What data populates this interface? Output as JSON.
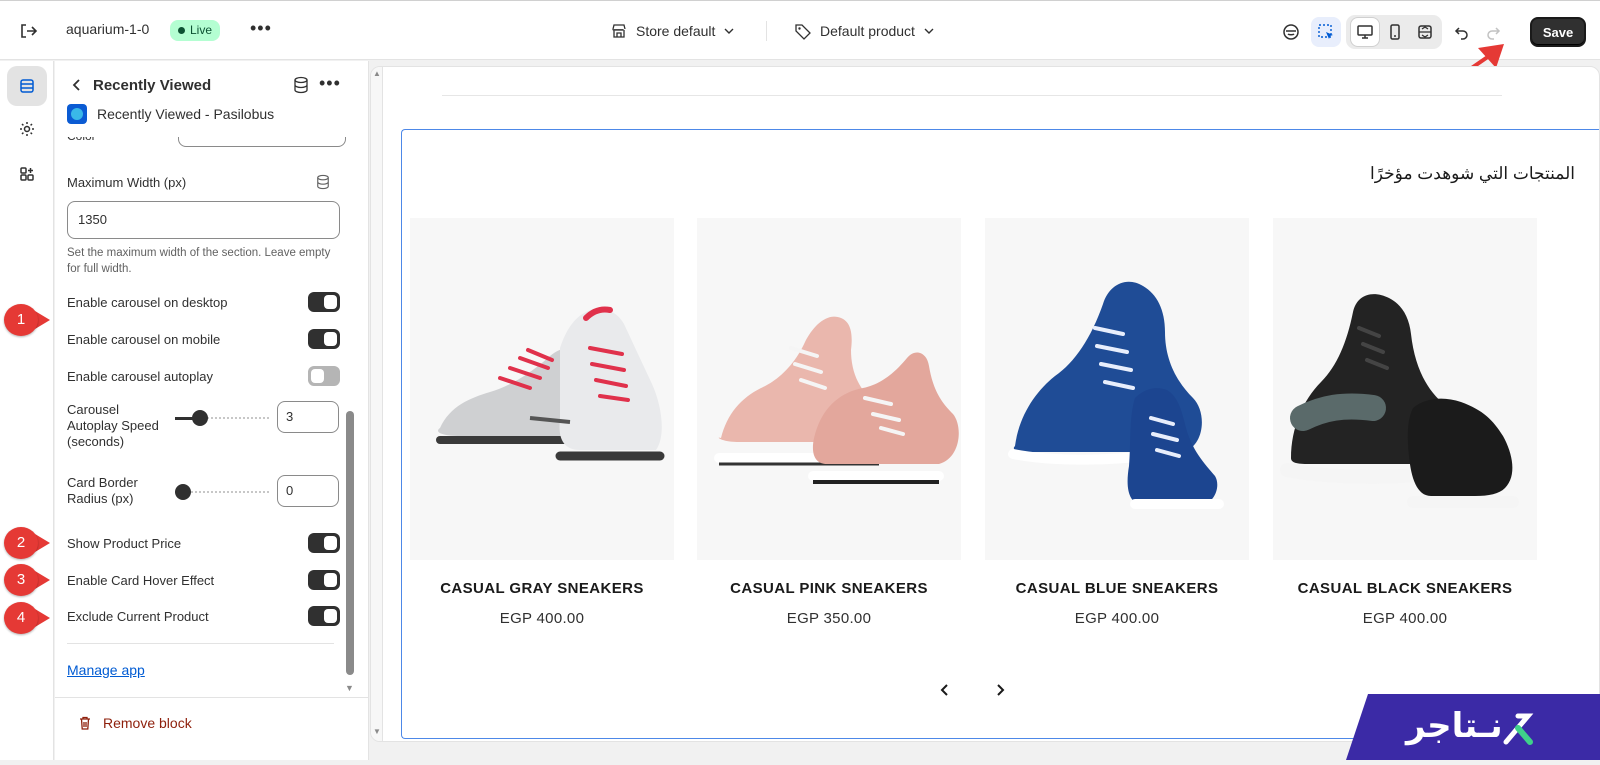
{
  "topbar": {
    "store_name": "aquarium-1-0",
    "status_badge": "Live",
    "more": "•••",
    "store_selector": "Store default",
    "product_selector": "Default product",
    "save_label": "Save"
  },
  "rail": {
    "items": [
      "sections-icon",
      "settings-gear-icon",
      "apps-icon"
    ]
  },
  "panel": {
    "title": "Recently Viewed",
    "app_name": "Recently Viewed - Pasilobus",
    "cut_label": "Color",
    "max_width_label": "Maximum Width (px)",
    "max_width_value": "1350",
    "max_width_help": "Set the maximum width of the section. Leave empty for full width.",
    "toggles": [
      {
        "label": "Enable carousel on desktop",
        "on": true
      },
      {
        "label": "Enable carousel on mobile",
        "on": true
      },
      {
        "label": "Enable carousel autoplay",
        "on": false
      }
    ],
    "autoplay_speed": {
      "label": "Carousel Autoplay Speed (seconds)",
      "value": "3"
    },
    "border_radius": {
      "label": "Card Border Radius (px)",
      "value": "0"
    },
    "toggles2": [
      {
        "label": "Show Product Price",
        "on": true
      },
      {
        "label": "Enable Card Hover Effect",
        "on": true
      },
      {
        "label": "Exclude Current Product",
        "on": true
      }
    ],
    "manage_link": "Manage app",
    "remove_label": "Remove block"
  },
  "annotations": [
    "1",
    "2",
    "3",
    "4"
  ],
  "preview": {
    "heading": "المنتجات التي شوهدت مؤخرًا",
    "products": [
      {
        "title": "CASUAL GRAY SNEAKERS",
        "price": "EGP 400.00",
        "color": "#d9d9d9",
        "accent": "#e0314b"
      },
      {
        "title": "CASUAL PINK SNEAKERS",
        "price": "EGP 350.00",
        "color": "#eab7ad",
        "accent": "#ffffff"
      },
      {
        "title": "CASUAL BLUE SNEAKERS",
        "price": "EGP 400.00",
        "color": "#1f4c96",
        "accent": "#ffffff"
      },
      {
        "title": "CASUAL BLACK SNEAKERS",
        "price": "EGP 400.00",
        "color": "#232323",
        "accent": "#ffffff"
      }
    ]
  },
  "brand": {
    "text": "تاجر",
    "prefix": "نـ",
    "bg": "#3b2aa6",
    "accent": "#3fd18a"
  },
  "colors": {
    "accent_blue": "#005bd3",
    "save_bg": "#303030",
    "live_bg": "#b4fed2",
    "annotation_red": "#e53935"
  }
}
